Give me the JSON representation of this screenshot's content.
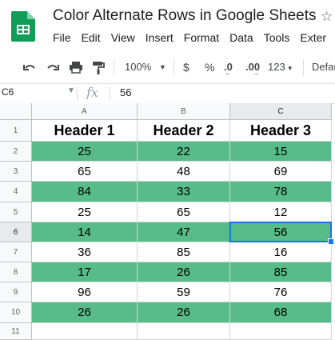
{
  "app": {
    "title": "Color Alternate Rows in Google Sheets",
    "menu": [
      "File",
      "Edit",
      "View",
      "Insert",
      "Format",
      "Data",
      "Tools",
      "Exter"
    ]
  },
  "toolbar": {
    "zoom": "100%",
    "currency": "$",
    "percent": "%",
    "dec_decrease": ".0",
    "dec_increase": ".00",
    "more_formats": "123",
    "font": "Defau"
  },
  "formula_bar": {
    "name_box": "C6",
    "fx": "fx",
    "value": "56"
  },
  "sheet": {
    "columns": [
      "A",
      "B",
      "C"
    ],
    "row_numbers": [
      "1",
      "2",
      "3",
      "4",
      "5",
      "6",
      "7",
      "8",
      "9",
      "10",
      "11"
    ],
    "headers": [
      "Header 1",
      "Header 2",
      "Header 3"
    ],
    "rows": [
      [
        "25",
        "22",
        "15"
      ],
      [
        "65",
        "48",
        "69"
      ],
      [
        "84",
        "33",
        "78"
      ],
      [
        "25",
        "65",
        "12"
      ],
      [
        "14",
        "47",
        "56"
      ],
      [
        "36",
        "85",
        "16"
      ],
      [
        "17",
        "26",
        "85"
      ],
      [
        "96",
        "59",
        "76"
      ],
      [
        "26",
        "26",
        "68"
      ]
    ],
    "highlight_color": "#57bb8a",
    "selected_cell": "C6"
  }
}
